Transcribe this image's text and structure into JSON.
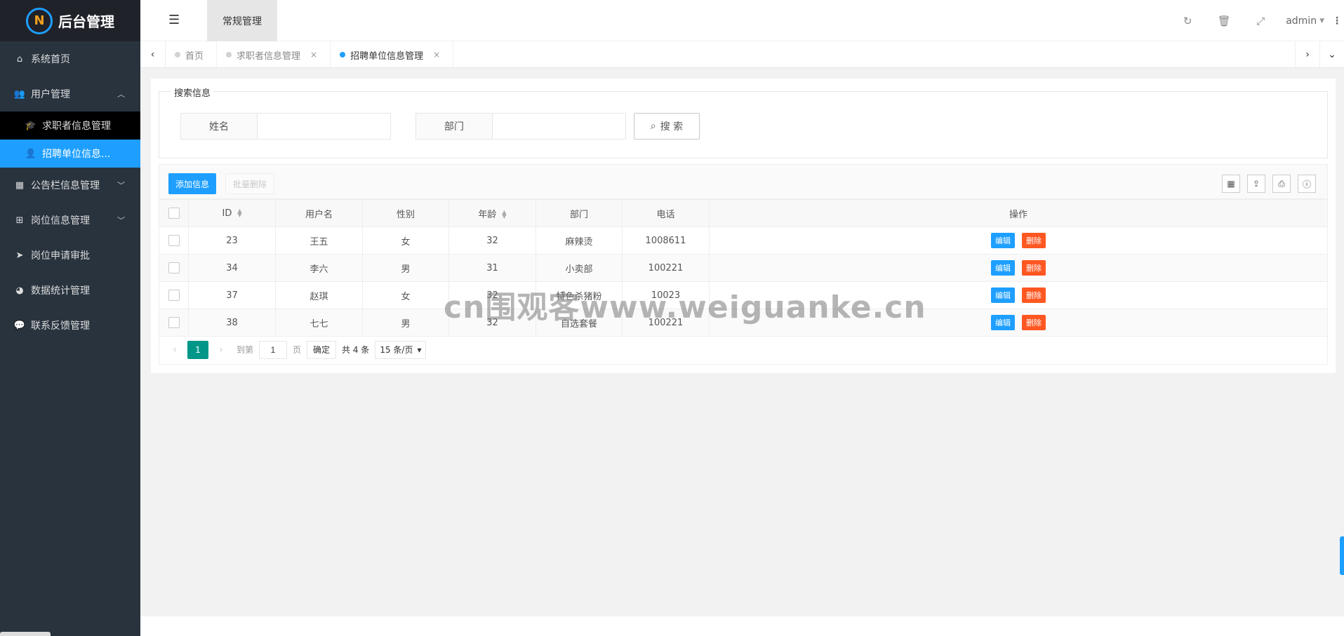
{
  "app": {
    "title": "后台管理"
  },
  "sidebar": {
    "items": [
      {
        "label": "系统首页",
        "icon": "home-icon"
      },
      {
        "label": "用户管理",
        "icon": "users-icon",
        "expanded": true,
        "children": [
          {
            "label": "求职者信息管理",
            "icon": "graduation-cap-icon"
          },
          {
            "label": "招聘单位信息...",
            "icon": "user-icon",
            "active": true
          }
        ]
      },
      {
        "label": "公告栏信息管理",
        "icon": "calendar-icon"
      },
      {
        "label": "岗位信息管理",
        "icon": "sitemap-icon"
      },
      {
        "label": "岗位申请审批",
        "icon": "paper-plane-icon"
      },
      {
        "label": "数据统计管理",
        "icon": "pie-chart-icon"
      },
      {
        "label": "联系反馈管理",
        "icon": "comments-icon"
      }
    ]
  },
  "header": {
    "tab_label": "常规管理",
    "user": "admin"
  },
  "tabs": [
    {
      "label": "首页"
    },
    {
      "label": "求职者信息管理"
    },
    {
      "label": "招聘单位信息管理",
      "active": true
    }
  ],
  "search": {
    "legend": "搜索信息",
    "name_label": "姓名",
    "name_value": "",
    "dept_label": "部门",
    "dept_value": "",
    "button_label": "搜 索"
  },
  "toolbar": {
    "add_label": "添加信息",
    "batch_delete_label": "批量删除"
  },
  "table": {
    "columns": [
      "ID",
      "用户名",
      "性别",
      "年龄",
      "部门",
      "电话",
      "操作"
    ],
    "rows": [
      {
        "id": "23",
        "username": "王五",
        "gender": "女",
        "age": "32",
        "dept": "麻辣烫",
        "phone": "1008611"
      },
      {
        "id": "34",
        "username": "李六",
        "gender": "男",
        "age": "31",
        "dept": "小卖部",
        "phone": "100221"
      },
      {
        "id": "37",
        "username": "赵琪",
        "gender": "女",
        "age": "32",
        "dept": "特色杀猪粉",
        "phone": "10023"
      },
      {
        "id": "38",
        "username": "七七",
        "gender": "男",
        "age": "32",
        "dept": "自选套餐",
        "phone": "100221"
      }
    ],
    "edit_label": "编辑",
    "delete_label": "删除"
  },
  "pager": {
    "current": "1",
    "goto_label": "到第",
    "goto_value": "1",
    "page_label": "页",
    "ok_label": "确定",
    "total": "共 4 条",
    "page_size": "15 条/页"
  },
  "watermark": "cn围观客www.weiguanke.cn",
  "colors": {
    "accent": "#1e9fff",
    "danger": "#ff5722",
    "pager_active": "#009688",
    "sidebar_bg": "#28333e"
  }
}
